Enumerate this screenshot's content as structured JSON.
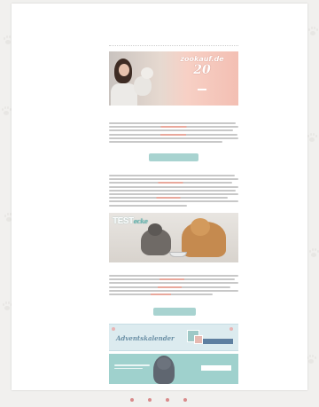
{
  "header": {
    "logo_text": "",
    "logo_subtitle": ""
  },
  "nav": {
    "items": [
      "",
      "",
      "",
      ""
    ]
  },
  "promo1": {
    "brand": "zookauf.de",
    "headline": "",
    "big_text": "20",
    "small_text": "",
    "code": ""
  },
  "section1": {
    "heading": "",
    "button_label": ""
  },
  "section2": {
    "heading": ""
  },
  "promo2": {
    "title": "TEST",
    "title_suffix": "ecke"
  },
  "section3": {
    "heading": "",
    "button_label": ""
  },
  "advent_banner": {
    "small_text": "",
    "title": "Adventskalender",
    "button_label": ""
  },
  "dog_banner": {
    "button_label": ""
  },
  "footer": {
    "links": [
      "",
      "",
      "",
      ""
    ]
  },
  "colors": {
    "accent": "#a8d3d0",
    "promo_pink": "#f3bfb3",
    "link_red": "#c26d6d"
  }
}
